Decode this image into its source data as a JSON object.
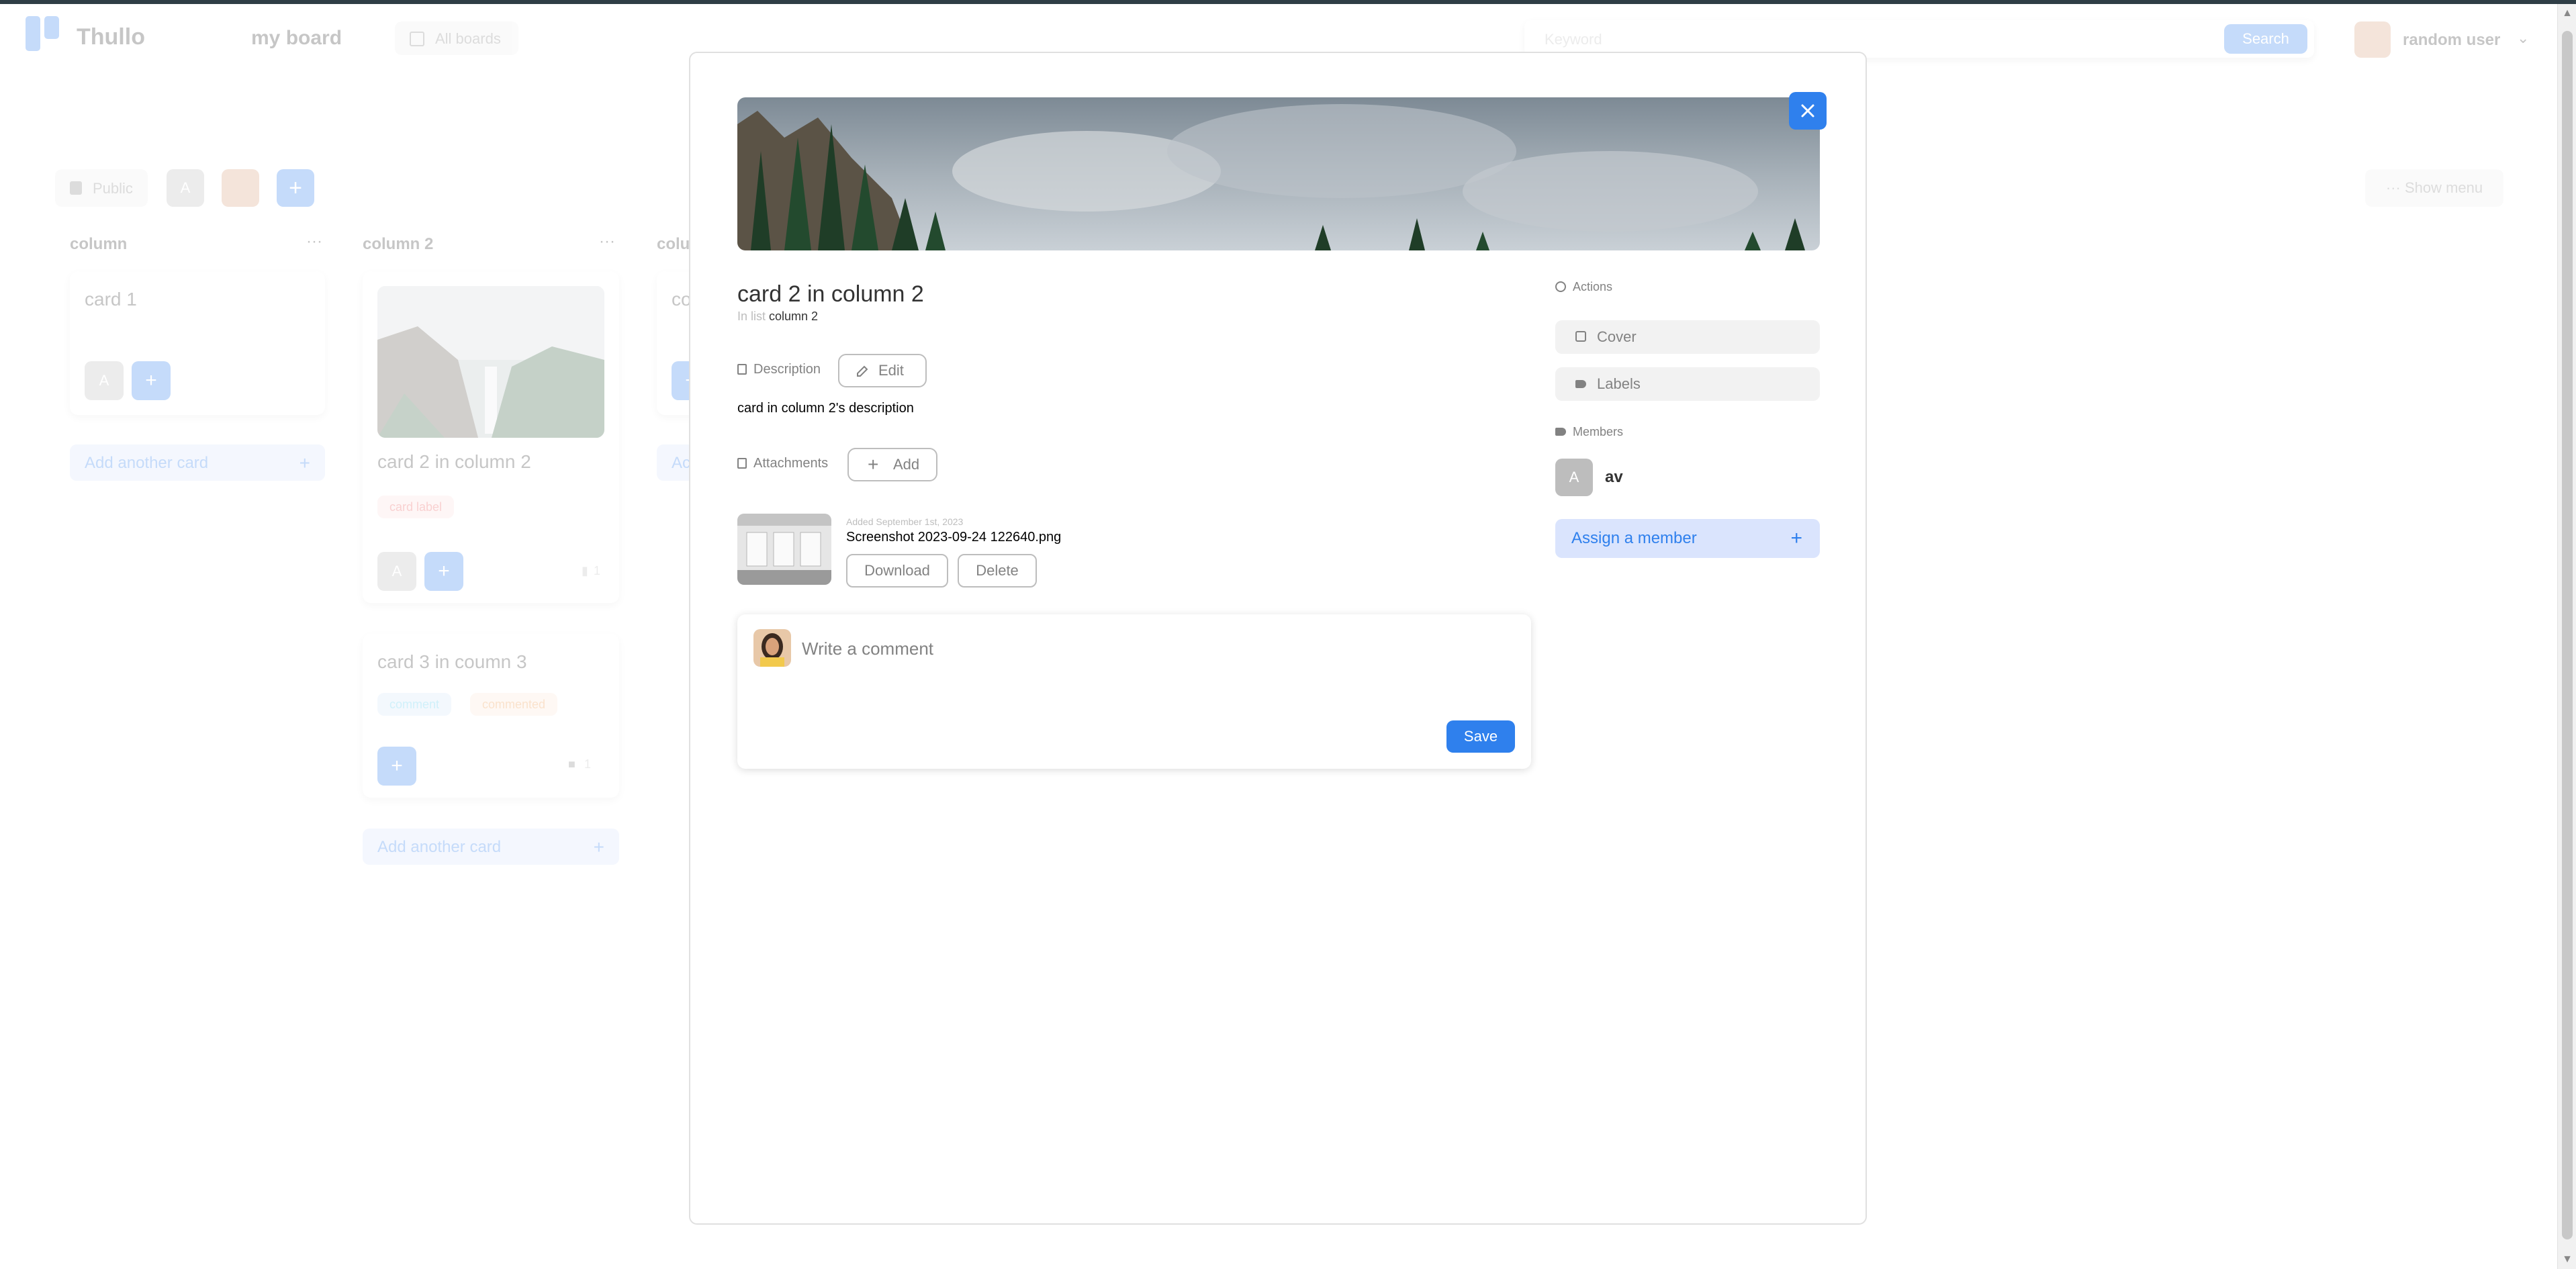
{
  "header": {
    "brand": "Thullo",
    "board_title": "my board",
    "all_boards": "All boards",
    "search_placeholder": "Keyword",
    "search_button": "Search",
    "user_name": "random user"
  },
  "board_bar": {
    "visibility": "Public",
    "member_initial": "A",
    "show_menu": "Show menu"
  },
  "columns": [
    {
      "title": "column",
      "cards": [
        {
          "title": "card 1",
          "member_initial": "A"
        }
      ],
      "add_card": "Add another card"
    },
    {
      "title": "column 2",
      "cards": [
        {
          "title": "card 2 in column 2",
          "labels": [
            "card label"
          ],
          "member_initial": "A",
          "attachment_count": "1"
        },
        {
          "title": "card 3 in coumn 3",
          "labels": [
            "comment",
            "commented"
          ],
          "comment_count": "1"
        }
      ],
      "add_card": "Add another card"
    },
    {
      "title": "colu",
      "cards": [
        {
          "title": "co"
        }
      ],
      "add_card": "Ac"
    }
  ],
  "modal": {
    "title": "card 2 in column 2",
    "in_list_prefix": "In list",
    "in_list_name": "column 2",
    "description_label": "Description",
    "edit_button": "Edit",
    "description_text": "card in column 2's description",
    "attachments_label": "Attachments",
    "add_button": "Add",
    "attachment": {
      "date": "Added September 1st, 2023",
      "filename": "Screenshot 2023-09-24 122640.png",
      "download": "Download",
      "delete": "Delete"
    },
    "comment_placeholder": "Write a comment",
    "save_button": "Save",
    "actions_label": "Actions",
    "cover_button": "Cover",
    "labels_button": "Labels",
    "members_label": "Members",
    "member": {
      "initial": "A",
      "name": "av"
    },
    "assign_member": "Assign a member"
  },
  "colors": {
    "accent": "#2f80ed",
    "accent_light": "#dae4fd",
    "muted": "#828282",
    "light_bg": "#f2f2f2"
  }
}
